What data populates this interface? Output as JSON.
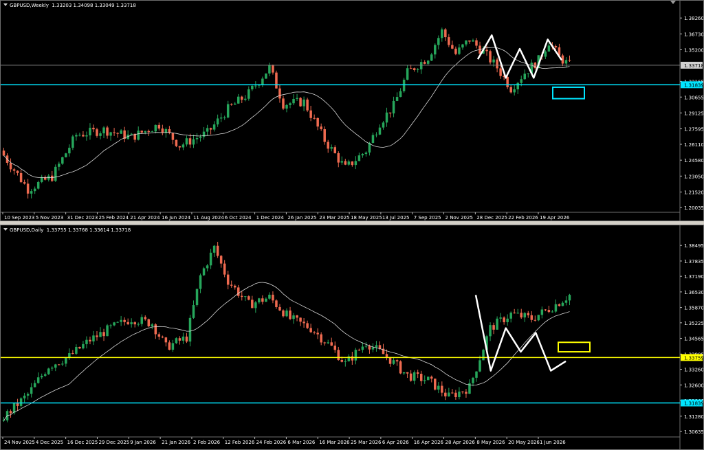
{
  "weekly": {
    "title": "GBPUSD,Weekly  1.33203 1.34098 1.33049 1.33718",
    "price_labels": [
      "1.38260",
      "1.36730",
      "1.35200",
      "1.33718",
      "1.32165",
      "1.31839",
      "1.30655",
      "1.29125",
      "1.27595",
      "1.26110",
      "1.24580",
      "1.23050",
      "1.21520",
      "1.20035"
    ],
    "current_label": "1.33718",
    "level_label": "1.31839",
    "date_labels": [
      "10 Sep 2023",
      "5 Nov 2023",
      "31 Dec 2023",
      "25 Feb 2024",
      "21 Apr 2024",
      "16 Jun 2024",
      "11 Aug 2024",
      "6 Oct 2024",
      "1 Dec 2024",
      "26 Jan 2025",
      "23 Mar 2025",
      "18 May 2025",
      "13 Jul 2025",
      "7 Sep 2025",
      "2 Nov 2025",
      "28 Dec 2025",
      "22 Feb 2026",
      "19 Apr 2026"
    ]
  },
  "daily": {
    "title": "GBPUSD,Daily  1.33755 1.33768 1.33614 1.33718",
    "price_labels": [
      "1.38495",
      "1.37835",
      "1.37190",
      "1.36530",
      "1.35870",
      "1.35225",
      "1.34565",
      "1.33905",
      "1.33759",
      "1.33260",
      "1.32600",
      "1.31940",
      "1.31839",
      "1.31280",
      "1.30635"
    ],
    "current_label": "1.33759",
    "level_label": "1.31839",
    "date_labels": [
      "24 Nov 2025",
      "4 Dec 2025",
      "16 Dec 2025",
      "29 Dec 2025",
      "9 Jan 2026",
      "21 Jan 2026",
      "2 Feb 2026",
      "12 Feb 2026",
      "24 Feb 2026",
      "6 Mar 2026",
      "16 Mar 2026",
      "25 Mar 2026",
      "6 Apr 2026",
      "16 Apr 2026",
      "28 Apr 2026",
      "8 May 2026",
      "20 May 2026",
      "1 Jun 2026"
    ]
  },
  "colors": {
    "bull": "#26a65b",
    "bear": "#ef6a50",
    "ma": "#d8d8d8",
    "cyan": "#00e5ff",
    "yellow": "#ffff00",
    "price_line": "#8c8c8c",
    "zigzag": "#ffffff"
  },
  "chart_data": [
    {
      "type": "candlestick",
      "title": "GBPUSD,Weekly  1.33203 1.34098 1.33049 1.33718",
      "ohlc_last": {
        "open": 1.33203,
        "high": 1.34098,
        "low": 1.33049,
        "close": 1.33718
      },
      "ylim": [
        1.197,
        1.39
      ],
      "x_labels": [
        "10 Sep 2023",
        "5 Nov 2023",
        "31 Dec 2023",
        "25 Feb 2024",
        "21 Apr 2024",
        "16 Jun 2024",
        "11 Aug 2024",
        "6 Oct 2024",
        "1 Dec 2024",
        "26 Jan 2025",
        "23 Mar 2025",
        "18 May 2025",
        "13 Jul 2025",
        "7 Sep 2025",
        "2 Nov 2025",
        "28 Dec 2025",
        "22 Feb 2026",
        "19 Apr 2026"
      ],
      "bars": 165,
      "horizontal_level": 1.31839,
      "current_price": 1.33718,
      "path_anchors": [
        [
          0,
          1.255
        ],
        [
          8,
          1.218
        ],
        [
          15,
          1.23
        ],
        [
          22,
          1.27
        ],
        [
          30,
          1.275
        ],
        [
          38,
          1.268
        ],
        [
          46,
          1.28
        ],
        [
          52,
          1.26
        ],
        [
          60,
          1.272
        ],
        [
          66,
          1.295
        ],
        [
          72,
          1.31
        ],
        [
          78,
          1.335
        ],
        [
          82,
          1.3
        ],
        [
          88,
          1.302
        ],
        [
          94,
          1.265
        ],
        [
          100,
          1.238
        ],
        [
          106,
          1.255
        ],
        [
          110,
          1.282
        ],
        [
          114,
          1.298
        ],
        [
          118,
          1.33
        ],
        [
          124,
          1.345
        ],
        [
          128,
          1.37
        ],
        [
          132,
          1.348
        ],
        [
          136,
          1.362
        ],
        [
          140,
          1.35
        ],
        [
          144,
          1.335
        ],
        [
          148,
          1.315
        ],
        [
          152,
          1.33
        ],
        [
          156,
          1.342
        ],
        [
          159,
          1.36
        ],
        [
          162,
          1.345
        ],
        [
          165,
          1.337
        ]
      ],
      "zigzag": [
        1.343,
        1.366,
        1.325,
        1.353,
        1.325,
        1.362,
        1.342
      ],
      "target_box": {
        "from_price": 1.316,
        "to_price": 1.305
      }
    },
    {
      "type": "candlestick",
      "title": "GBPUSD,Daily  1.33755 1.33768 1.33614 1.33718",
      "ohlc_last": {
        "open": 1.33755,
        "high": 1.33768,
        "low": 1.33614,
        "close": 1.33718
      },
      "ylim": [
        1.3046,
        1.3882
      ],
      "x_labels": [
        "24 Nov 2025",
        "4 Dec 2025",
        "16 Dec 2025",
        "29 Dec 2025",
        "9 Jan 2026",
        "21 Jan 2026",
        "2 Feb 2026",
        "12 Feb 2026",
        "24 Feb 2026",
        "6 Mar 2026",
        "16 Mar 2026",
        "25 Mar 2026",
        "6 Apr 2026",
        "16 Apr 2026",
        "28 Apr 2026",
        "8 May 2026",
        "20 May 2026",
        "1 Jun 2026"
      ],
      "bars": 165,
      "horizontal_level": 1.31839,
      "current_price": 1.33759,
      "path_anchors": [
        [
          0,
          1.311
        ],
        [
          8,
          1.322
        ],
        [
          14,
          1.334
        ],
        [
          20,
          1.338
        ],
        [
          26,
          1.345
        ],
        [
          32,
          1.35
        ],
        [
          38,
          1.354
        ],
        [
          44,
          1.352
        ],
        [
          48,
          1.342
        ],
        [
          54,
          1.346
        ],
        [
          58,
          1.372
        ],
        [
          62,
          1.384
        ],
        [
          66,
          1.37
        ],
        [
          72,
          1.36
        ],
        [
          78,
          1.363
        ],
        [
          84,
          1.354
        ],
        [
          90,
          1.35
        ],
        [
          96,
          1.342
        ],
        [
          100,
          1.335
        ],
        [
          106,
          1.344
        ],
        [
          112,
          1.338
        ],
        [
          118,
          1.33
        ],
        [
          124,
          1.328
        ],
        [
          130,
          1.321
        ],
        [
          136,
          1.325
        ],
        [
          142,
          1.35
        ],
        [
          148,
          1.356
        ],
        [
          154,
          1.354
        ],
        [
          160,
          1.359
        ],
        [
          166,
          1.365
        ],
        [
          170,
          1.354
        ]
      ],
      "zigzag": [
        1.364,
        1.332,
        1.35,
        1.34,
        1.348,
        1.332,
        1.336
      ],
      "target_box": {
        "from_price": 1.344,
        "to_price": 1.34
      }
    }
  ]
}
